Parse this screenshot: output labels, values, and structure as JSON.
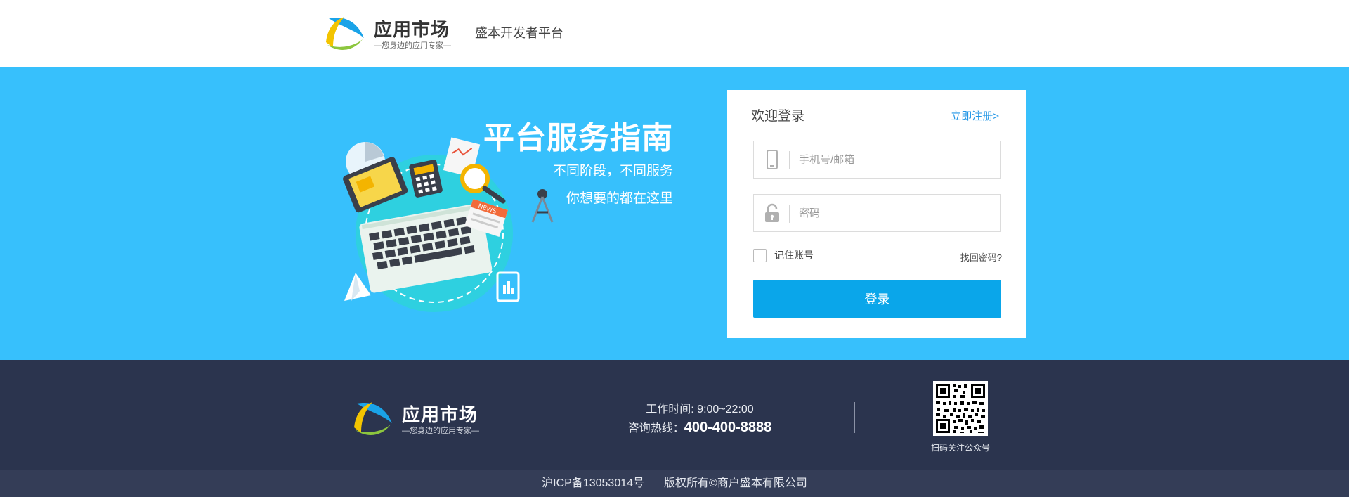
{
  "header": {
    "logo_title": "应用市场",
    "logo_subtitle": "—您身边的应用专家—",
    "platform_name": "盛本开发者平台"
  },
  "hero": {
    "title": "平台服务指南",
    "line1": "不同阶段，不同服务",
    "line2": "你想要的都在这里",
    "illustration_news_label": "NEWS"
  },
  "login": {
    "title": "欢迎登录",
    "register_link": "立即注册>",
    "phone_placeholder": "手机号/邮箱",
    "password_placeholder": "密码",
    "remember_label": "记住账号",
    "forgot_link": "找回密码?",
    "submit_label": "登录"
  },
  "footer": {
    "logo_title": "应用市场",
    "logo_subtitle": "—您身边的应用专家—",
    "hours": "工作时间: 9:00~22:00",
    "hotline_label": "咨询热线：",
    "hotline_number": "400-400-8888",
    "qr_label": "扫码关注公众号",
    "icp": "沪ICP备13053014号",
    "copyright": "版权所有©商户盛本有限公司"
  },
  "colors": {
    "hero_bg": "#37c0fc",
    "footer_bg": "#2b344e",
    "copyright_bg": "#343d57",
    "button": "#0aa6ea",
    "link": "#2196e6"
  },
  "icons": [
    "logo-mark",
    "phone-icon",
    "lock-icon",
    "qr-code"
  ]
}
